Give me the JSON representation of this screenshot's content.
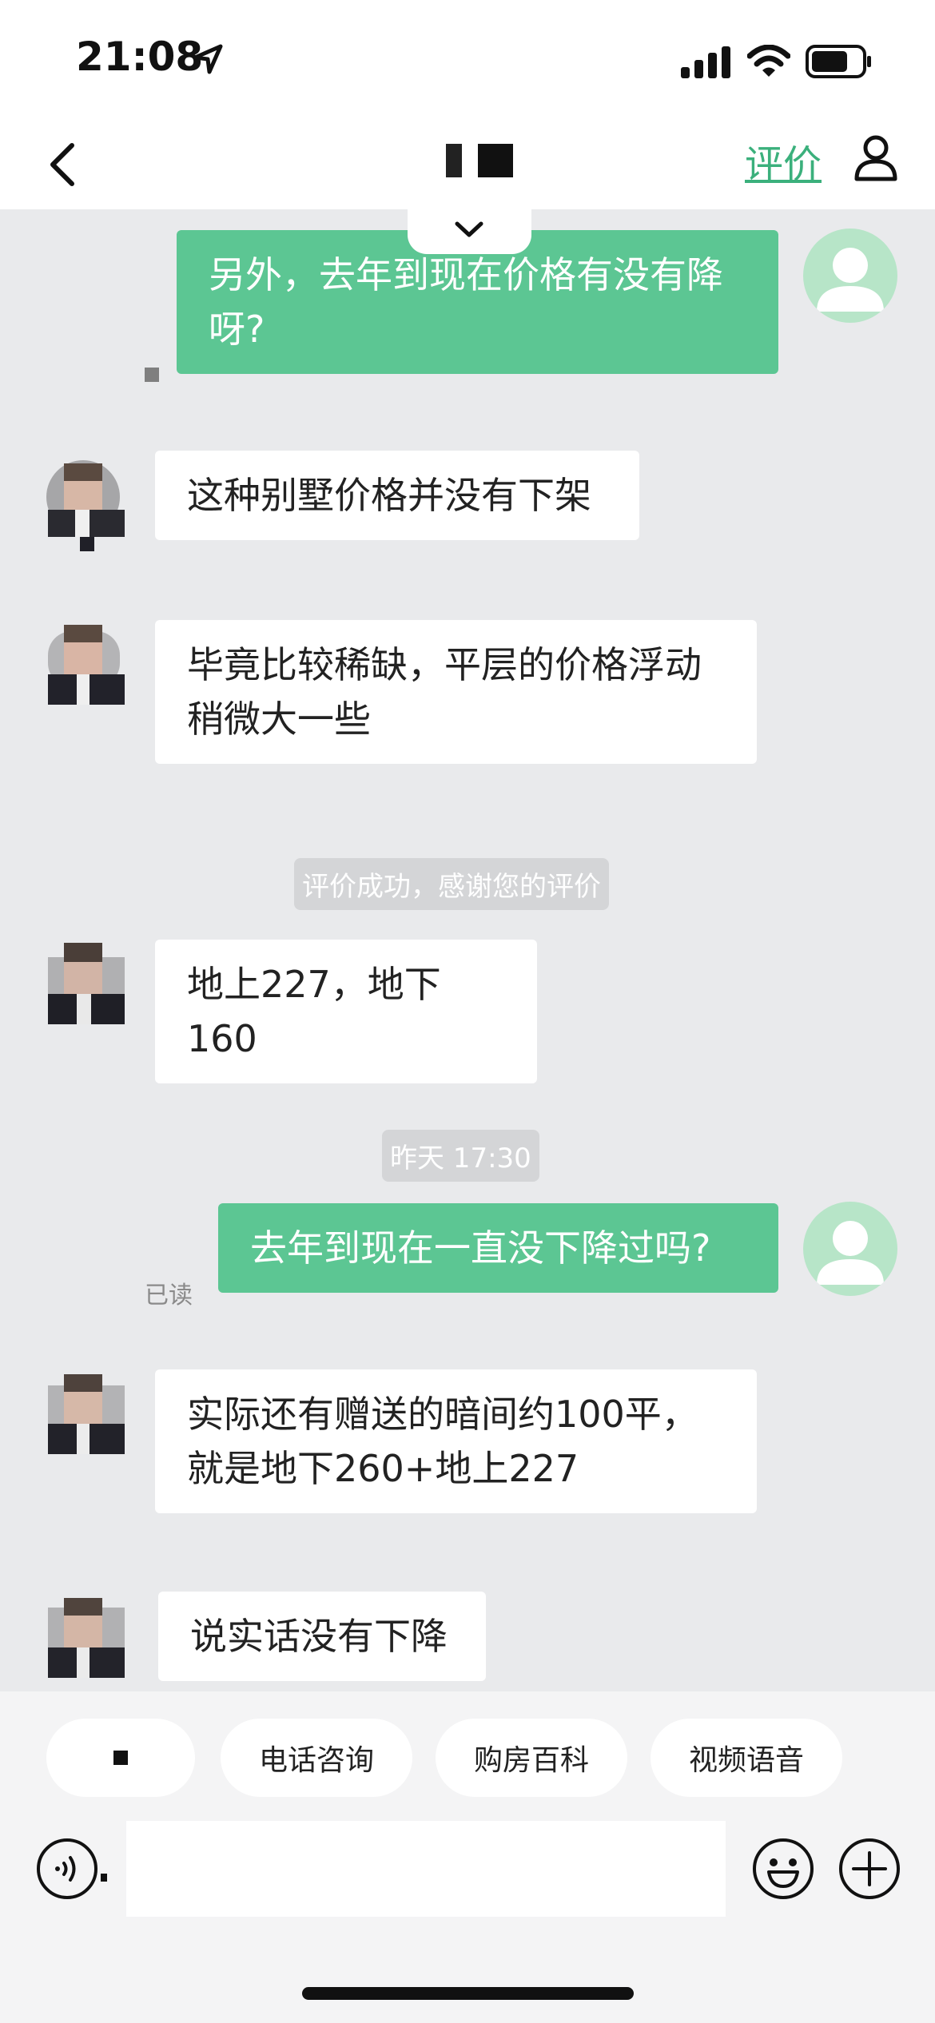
{
  "status_bar": {
    "time": "21:08"
  },
  "nav": {
    "rate_label": "评价"
  },
  "messages": [
    {
      "text": "另外，去年到现在价格有没有降呀?"
    },
    {
      "text": "这种别墅价格并没有下架"
    },
    {
      "text": "毕竟比较稀缺，平层的价格浮动稍微大一些"
    },
    {
      "text": "评价成功，感谢您的评价"
    },
    {
      "text": "地上227，地下160"
    },
    {
      "text": "昨天 17:30"
    },
    {
      "text": "去年到现在一直没下降过吗?",
      "status": "已读"
    },
    {
      "text": "实际还有赠送的暗间约100平，就是地下260+地上227"
    },
    {
      "text": "说实话没有下降"
    }
  ],
  "quick_actions": [
    "电话咨询",
    "购房百科",
    "视频语音"
  ],
  "input": {
    "placeholder": ""
  },
  "colors": {
    "accent": "#3bb07c",
    "outgoing_bubble": "#5cc693",
    "background": "#e9eaec"
  },
  "icons": [
    "back-icon",
    "location-arrow-icon",
    "signal-icon",
    "wifi-icon",
    "battery-icon",
    "person-icon",
    "chevron-down-icon",
    "voice-icon",
    "emoji-icon",
    "plus-icon"
  ]
}
